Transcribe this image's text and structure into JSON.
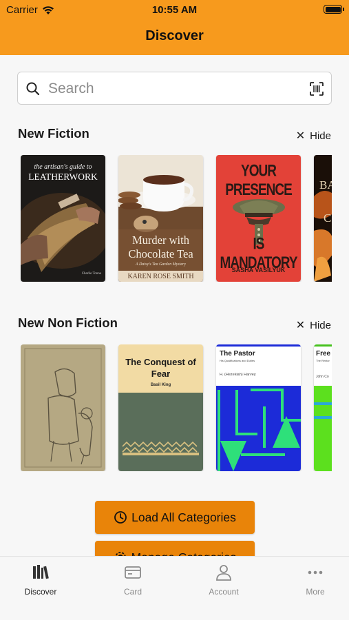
{
  "status_bar": {
    "carrier": "Carrier",
    "time": "10:55 AM"
  },
  "header": {
    "title": "Discover"
  },
  "search": {
    "placeholder": "Search"
  },
  "sections": [
    {
      "title": "New Fiction",
      "hide_label": "Hide",
      "books": [
        {
          "title_top": "the artisan's guide to",
          "title_main": "LEATHERWORK",
          "author": "Charlie Tonne"
        },
        {
          "title_main": "Murder with Chocolate Tea",
          "subtitle": "A Daisy's Tea Garden Mystery",
          "author": "KAREN ROSE SMITH"
        },
        {
          "title_main": "YOUR PRESENCE",
          "title_bottom": "IS MANDATORY",
          "author": "SASHA VASILYUK"
        },
        {
          "title_main": "BA",
          "subtitle": "C"
        }
      ]
    },
    {
      "title": "New Non Fiction",
      "hide_label": "Hide",
      "books": [
        {
          "title_main": ""
        },
        {
          "title_main": "The Conquest of Fear",
          "author": "Basil King"
        },
        {
          "title_main": "The Pastor",
          "subtitle": "His Qualifications and Duties",
          "author": "H. (Hezekiah) Harvey"
        },
        {
          "title_main": "Free",
          "subtitle": "The Restor",
          "author": "John Co"
        }
      ]
    }
  ],
  "buttons": {
    "load_all": "Load All Categories",
    "manage": "Manage Categories"
  },
  "tabs": [
    {
      "label": "Discover"
    },
    {
      "label": "Card"
    },
    {
      "label": "Account"
    },
    {
      "label": "More"
    }
  ],
  "colors": {
    "header": "#f79a1d",
    "button": "#e98409"
  }
}
